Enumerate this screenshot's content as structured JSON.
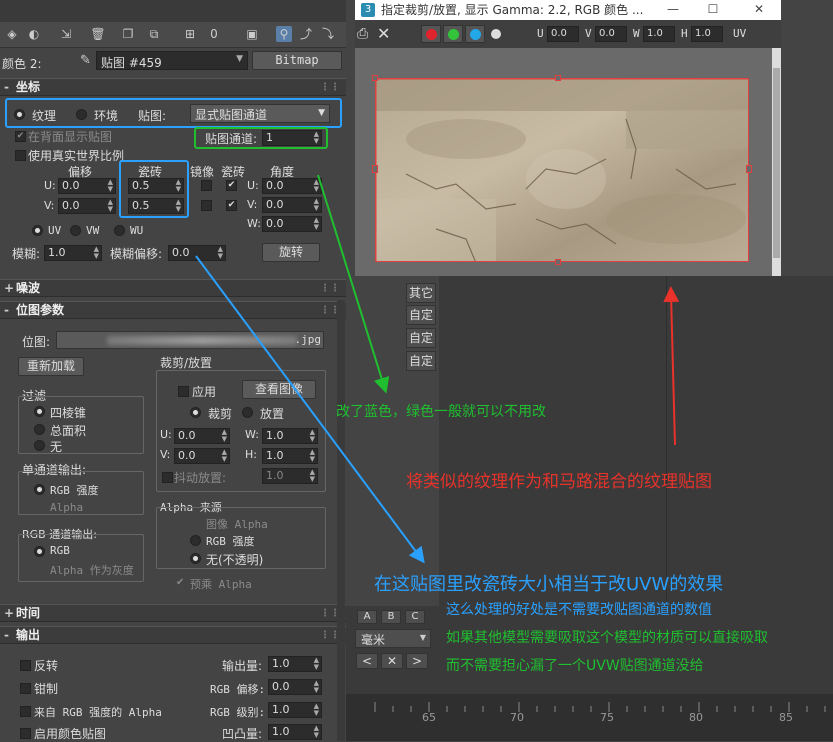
{
  "left_panel": {
    "color_label": "颜色 2:",
    "map_label": "贴图 #459",
    "map_type_button": "Bitmap",
    "coords_rollout": "坐标",
    "coords": {
      "texture_label": "纹理",
      "environ_label": "环境",
      "mapping_label": "贴图:",
      "mapping_value": "显式贴图通道",
      "show_back_label": "在背面显示贴图",
      "channel_label": "贴图通道:",
      "channel_value": "1",
      "real_world_label": "使用真实世界比例",
      "offset_label": "偏移",
      "tiling_label": "瓷砖",
      "mirror_label": "镜像",
      "tile_label": "瓷砖",
      "angle_label": "角度",
      "u_label": "U:",
      "v_label": "V:",
      "w_label": "W:",
      "u_offset": "0.0",
      "v_offset": "0.0",
      "u_tiling": "0.5",
      "v_tiling": "0.5",
      "u_angle": "0.0",
      "v_angle": "0.0",
      "w_angle": "0.0",
      "uv_label": "UV",
      "vw_label": "VW",
      "wu_label": "WU",
      "blur_label": "模糊:",
      "blur_value": "1.0",
      "blur_offset_label": "模糊偏移:",
      "blur_offset_value": "0.0",
      "rotate_button": "旋转"
    },
    "noise_rollout": "噪波",
    "bitmap_rollout": "位图参数",
    "bitmap": {
      "bitmap_label": "位图:",
      "bitmap_path_suffix": ".jpg",
      "reload_button": "重新加载",
      "crop_group": "裁剪/放置",
      "apply_label": "应用",
      "view_image_button": "查看图像",
      "crop_label": "裁剪",
      "place_label": "放置",
      "u_value": "0.0",
      "w_value": "1.0",
      "v_value": "0.0",
      "h_value": "1.0",
      "jitter_label": "抖动放置:",
      "jitter_value": "1.0",
      "filter_group": "过滤",
      "filter_pyramidal": "四棱锥",
      "filter_summed": "总面积",
      "filter_none": "无",
      "mono_output_group": "单通道输出:",
      "mono_rgb": "RGB 强度",
      "mono_alpha": "Alpha",
      "rgb_output_group": "RGB 通道输出:",
      "rgb_rgb": "RGB",
      "rgb_alpha_gray": "Alpha 作为灰度",
      "alpha_source_group": "Alpha 来源",
      "alpha_image": "图像 Alpha",
      "alpha_rgb": "RGB 强度",
      "alpha_none": "无(不透明)",
      "premult_label": "预乘 Alpha"
    },
    "time_rollout": "时间",
    "output_rollout": "输出",
    "output": {
      "invert_label": "反转",
      "output_amount_label": "输出量:",
      "output_amount": "1.0",
      "clamp_label": "钳制",
      "rgb_offset_label": "RGB 偏移:",
      "rgb_offset": "0.0",
      "from_rgb_alpha_label": "来自 RGB 强度的 Alpha",
      "rgb_level_label": "RGB 级别:",
      "rgb_level": "1.0",
      "enable_color_map_label": "启用颜色贴图",
      "bump_label": "凹凸量:",
      "bump_value": "1.0"
    }
  },
  "viewer": {
    "title": "指定裁剪/放置, 显示 Gamma: 2.2, RGB 颜色 ...",
    "u_label": "U",
    "u_value": "0.0",
    "v_label": "V",
    "v_value": "0.0",
    "w_label": "W",
    "w_value": "1.0",
    "h_label": "H",
    "h_value": "1.0",
    "uv_label": "UV",
    "minimize_icon": "—",
    "maximize_icon": "☐",
    "close_icon": "✕"
  },
  "right_panel": {
    "list_items": [
      "其它",
      "自定",
      "自定",
      "自定"
    ],
    "abc_buttons": [
      "A",
      "B",
      "C"
    ],
    "unit_value": "毫米",
    "timeline_ticks": [
      "65",
      "70",
      "75",
      "80",
      "85"
    ]
  },
  "annotations": {
    "green_note": "改了蓝色，绿色一般就可以不用改",
    "red_note": "将类似的纹理作为和马路混合的纹理贴图",
    "blue_note": "在这贴图里改瓷砖大小相当于改UVW的效果",
    "note_line_1": "这么处理的好处是不需要改贴图通道的数值",
    "note_line_2": "如果其他模型需要吸取这个模型的材质可以直接吸取",
    "note_line_3": "而不需要担心漏了一个UVW贴图通道没给"
  },
  "colors": {
    "blue": "#2aa0ff",
    "green": "#1fbf2f",
    "red": "#e8322a"
  }
}
